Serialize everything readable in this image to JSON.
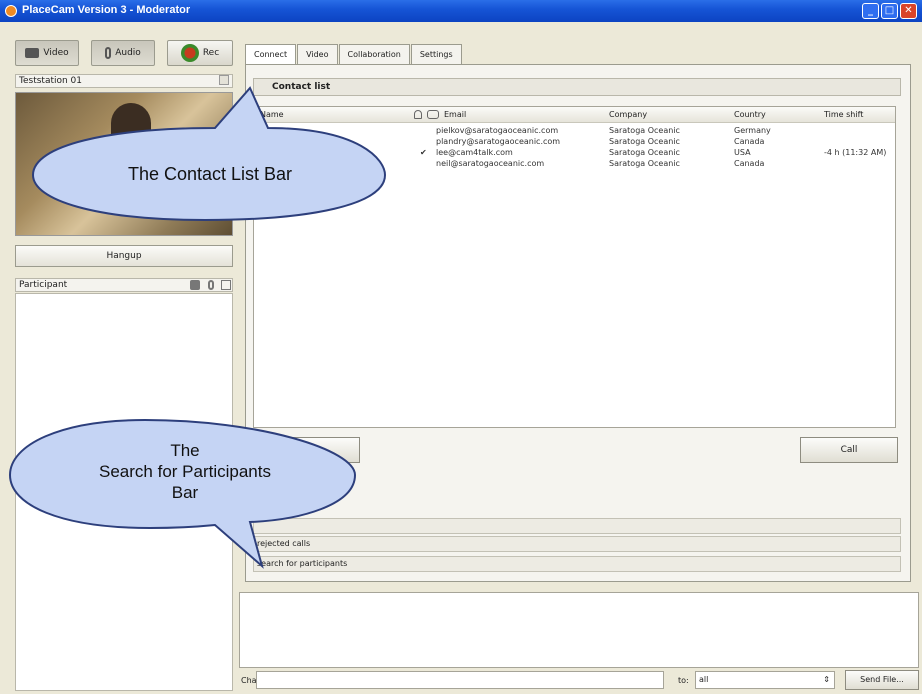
{
  "window": {
    "title": "PlaceCam Version 3 - Moderator"
  },
  "toolbar": {
    "video_label": "Video",
    "audio_label": "Audio",
    "rec_label": "Rec"
  },
  "video_panel": {
    "header": "Teststation 01",
    "hangup_label": "Hangup"
  },
  "participants": {
    "header": "Participant"
  },
  "tabs": [
    {
      "label": "Connect"
    },
    {
      "label": "Video"
    },
    {
      "label": "Collaboration"
    },
    {
      "label": "Settings"
    }
  ],
  "contact_list": {
    "header": "Contact list",
    "columns": [
      "Name",
      "Email",
      "Company",
      "Country",
      "Time shift"
    ],
    "rows": [
      {
        "check": "",
        "email": "pielkov@saratogaoceanic.com",
        "company": "Saratoga Oceanic",
        "country": "Germany",
        "timeshift": ""
      },
      {
        "check": "",
        "email": "plandry@saratogaoceanic.com",
        "company": "Saratoga Oceanic",
        "country": "Canada",
        "timeshift": ""
      },
      {
        "check": "✔",
        "email": "lee@cam4talk.com",
        "company": "Saratoga Oceanic",
        "country": "USA",
        "timeshift": "-4 h (11:32 AM)"
      },
      {
        "check": "",
        "email": "neil@saratogaoceanic.com",
        "company": "Saratoga Oceanic",
        "country": "Canada",
        "timeshift": ""
      }
    ],
    "call_label": "Call"
  },
  "sections": {
    "rejected": "rejected calls",
    "search": "search for participants"
  },
  "chat": {
    "label": "Chat:",
    "to_label": "to:",
    "to_value": "all",
    "send_file_label": "Send File..."
  },
  "annotations": {
    "contact_bar": "The Contact List Bar",
    "search_bar_line1": "The",
    "search_bar_line2": "Search for Participants",
    "search_bar_line3": "Bar"
  }
}
